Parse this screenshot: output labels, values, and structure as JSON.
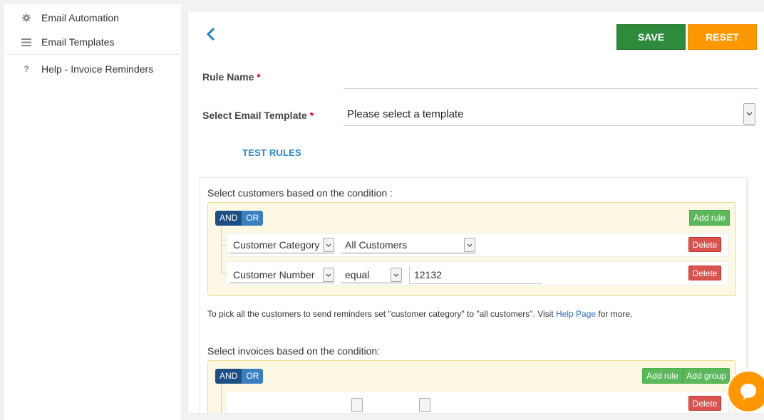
{
  "sidebar": {
    "items": [
      {
        "label": "Email Automation",
        "icon": "gear-icon"
      },
      {
        "label": "Email Templates",
        "icon": "list-icon"
      },
      {
        "label": "Help - Invoice Reminders",
        "icon": "question-icon"
      }
    ]
  },
  "toolbar": {
    "save_label": "SAVE",
    "reset_label": "RESET",
    "back_icon": "chevron-left-icon"
  },
  "form": {
    "rule_name_label": "Rule Name",
    "rule_name_value": "",
    "template_label": "Select Email Template",
    "required_mark": "*",
    "template_value": "Please select a template",
    "test_rules_label": "TEST RULES"
  },
  "customers": {
    "title": "Select customers based on the condition :",
    "and_label": "AND",
    "or_label": "OR",
    "add_rule_label": "Add rule",
    "rules": [
      {
        "field": "Customer Category",
        "operator": "All Customers",
        "value": null,
        "delete_label": "Delete"
      },
      {
        "field": "Customer Number",
        "operator": "equal",
        "value": "12132",
        "delete_label": "Delete"
      }
    ],
    "note_text": "To pick all the customers to send reminders set \"customer category\" to \"all customers\". Visit ",
    "note_link": "Help Page",
    "note_suffix": " for more."
  },
  "invoices": {
    "title": "Select invoices based on the condition:",
    "and_label": "AND",
    "or_label": "OR",
    "add_rule_label": "Add rule",
    "add_group_label": "Add group",
    "delete_label": "Delete"
  },
  "colors": {
    "save": "#2e8b3c",
    "reset": "#ff9800",
    "link": "#2a88c9",
    "delete": "#d9534f",
    "add": "#5cb85c",
    "and": "#1e4f84",
    "or": "#3a7fc0"
  },
  "chat": {
    "icon": "chat-bubble-icon"
  }
}
